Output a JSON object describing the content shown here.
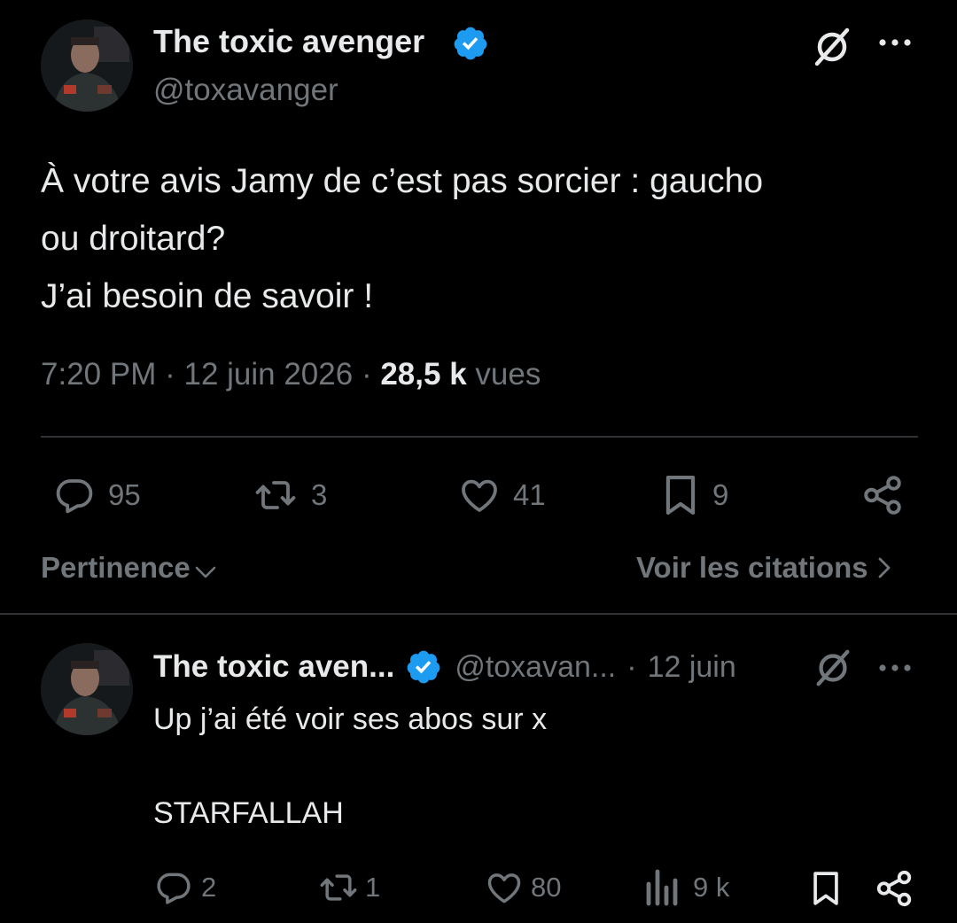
{
  "main_post": {
    "author_name": "The toxic avenger",
    "handle": "@toxavanger",
    "text_lines": [
      "À votre avis Jamy de c’est pas sorcier : gaucho",
      "ou droitard?",
      "J’ai besoin de savoir !"
    ],
    "time": "7:20 PM",
    "sep1": "·",
    "date": "12 juin 2026",
    "sep2": "·",
    "views_count": "28,5 k",
    "views_label": "vues",
    "actions": {
      "replies": "95",
      "reposts": "3",
      "likes": "41",
      "bookmarks": "9"
    }
  },
  "sort": {
    "label": "Pertinence",
    "quotes_link": "Voir les citations"
  },
  "reply": {
    "author_name": "The toxic aven...",
    "handle": "@toxavan...",
    "sep": "·",
    "date": "12 juin",
    "text_line1": "Up j’ai été voir ses abos sur x",
    "text_line2": "STARFALLAH",
    "actions": {
      "replies": "2",
      "reposts": "1",
      "likes": "80",
      "views": "9 k"
    }
  },
  "colors": {
    "background": "#000000",
    "text": "#e7e9ea",
    "secondary": "#71767b",
    "verified": "#1d9bf0",
    "divider": "#2f3336"
  },
  "icons": [
    "verified-badge-icon",
    "grok-icon",
    "more-icon",
    "reply-icon",
    "repost-icon",
    "like-icon",
    "bookmark-icon",
    "share-icon",
    "chevron-down-icon",
    "chevron-right-icon",
    "views-icon"
  ]
}
